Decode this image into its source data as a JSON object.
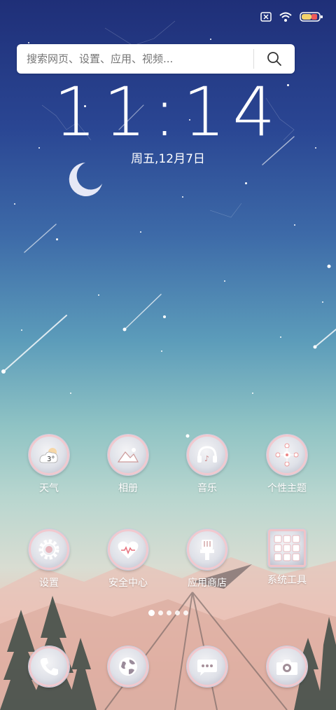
{
  "status_bar": {
    "icons": [
      "sim-missing-icon",
      "wifi-icon",
      "battery-icon"
    ],
    "battery_level": 0.3
  },
  "search": {
    "placeholder": "搜索网页、设置、应用、视频..."
  },
  "clock": {
    "time": "11:14",
    "date": "周五,12月7日"
  },
  "apps_row1": [
    {
      "label": "天气",
      "icon": "weather-icon",
      "badge": "3°"
    },
    {
      "label": "相册",
      "icon": "gallery-icon"
    },
    {
      "label": "音乐",
      "icon": "music-icon"
    },
    {
      "label": "个性主题",
      "icon": "themes-icon"
    }
  ],
  "apps_row2": [
    {
      "label": "设置",
      "icon": "gear-icon"
    },
    {
      "label": "安全中心",
      "icon": "security-heart-icon"
    },
    {
      "label": "应用商店",
      "icon": "app-store-icon"
    },
    {
      "label": "系统工具",
      "icon": "tools-folder-icon"
    }
  ],
  "page_indicator": {
    "count": 5,
    "active": 0
  },
  "dock": [
    {
      "icon": "phone-icon"
    },
    {
      "icon": "browser-globe-icon"
    },
    {
      "icon": "messages-icon"
    },
    {
      "icon": "camera-icon"
    }
  ],
  "colors": {
    "sky_top": "#1f2f78",
    "sky_mid": "#5c9cba",
    "horizon": "#efc4b7",
    "icon_ring": "#f1c9cf"
  }
}
